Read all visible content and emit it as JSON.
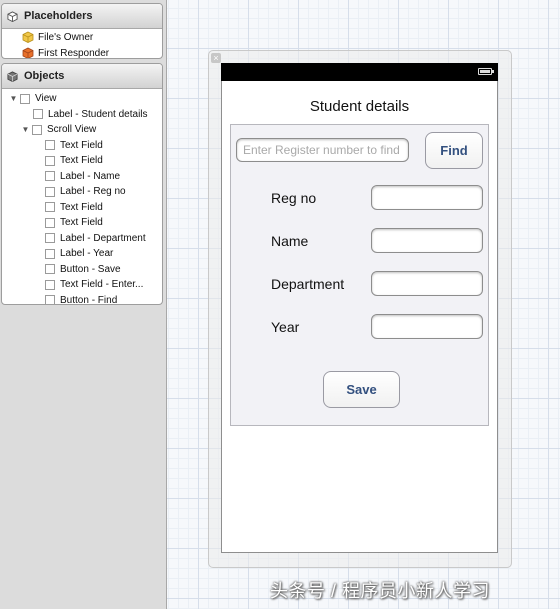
{
  "placeholders": {
    "title": "Placeholders",
    "items": [
      {
        "label": "File's Owner",
        "icon": "cube-icon",
        "color": "#f1c84a"
      },
      {
        "label": "First Responder",
        "icon": "cube-icon",
        "color": "#e8702a"
      }
    ]
  },
  "objects": {
    "title": "Objects",
    "items": [
      {
        "label": "View",
        "expanded": true
      },
      {
        "label": "Label - Student details"
      },
      {
        "label": "Scroll View",
        "expanded": true
      },
      {
        "label": "Text Field"
      },
      {
        "label": "Text Field"
      },
      {
        "label": "Label - Name"
      },
      {
        "label": "Label - Reg no"
      },
      {
        "label": "Text Field"
      },
      {
        "label": "Text Field"
      },
      {
        "label": "Label - Department"
      },
      {
        "label": "Label - Year"
      },
      {
        "label": "Button - Save"
      },
      {
        "label": "Text Field - Enter..."
      },
      {
        "label": "Button - Find"
      }
    ]
  },
  "canvas": {
    "close_glyph": "×",
    "title": "Student details",
    "search_placeholder": "Enter Register number to find",
    "find_label": "Find",
    "labels": {
      "reg_no": "Reg no",
      "name": "Name",
      "department": "Department",
      "year": "Year"
    },
    "save_label": "Save"
  },
  "watermark": "头条号 / 程序员小新人学习"
}
